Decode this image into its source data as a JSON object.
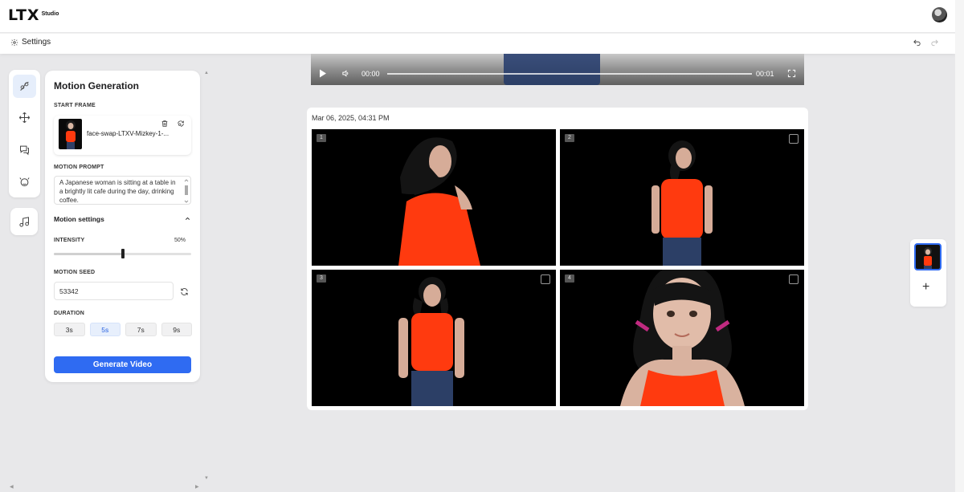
{
  "app": {
    "logo_text": "LTX",
    "logo_sub": "Studio"
  },
  "settings_bar": {
    "settings_label": "Settings"
  },
  "panel": {
    "title": "Motion Generation",
    "start_frame_label": "START FRAME",
    "start_frame_name": "face-swap-LTXV-Mizkey-1-...",
    "motion_prompt_label": "MOTION PROMPT",
    "motion_prompt_value": "A Japanese woman is sitting at a table in a brightly lit cafe during the day, drinking coffee.",
    "motion_settings_label": "Motion settings",
    "intensity_label": "INTENSITY",
    "intensity_value": "50%",
    "intensity_fraction": 0.5,
    "motion_seed_label": "MOTION SEED",
    "motion_seed_value": "53342",
    "duration_label": "DURATION",
    "durations": [
      "3s",
      "5s",
      "7s",
      "9s"
    ],
    "selected_duration": "5s",
    "generate_label": "Generate Video"
  },
  "video": {
    "current_time": "00:00",
    "duration": "00:01"
  },
  "generation": {
    "date": "Mar 06, 2025, 04:31 PM",
    "tiles": [
      {
        "number": "1"
      },
      {
        "number": "2"
      },
      {
        "number": "3"
      },
      {
        "number": "4"
      }
    ]
  },
  "colors": {
    "accent": "#2f6bf2",
    "shirt": "#ff3a0f",
    "background": "#e8e8ea"
  },
  "icons": {
    "settings": "gear-icon",
    "undo": "undo-icon",
    "redo": "redo-icon",
    "delete": "trash-icon",
    "replace": "replace-icon",
    "refresh": "refresh-icon",
    "play": "play-icon",
    "volume": "volume-icon",
    "fullscreen": "fullscreen-icon",
    "add": "plus-icon"
  }
}
